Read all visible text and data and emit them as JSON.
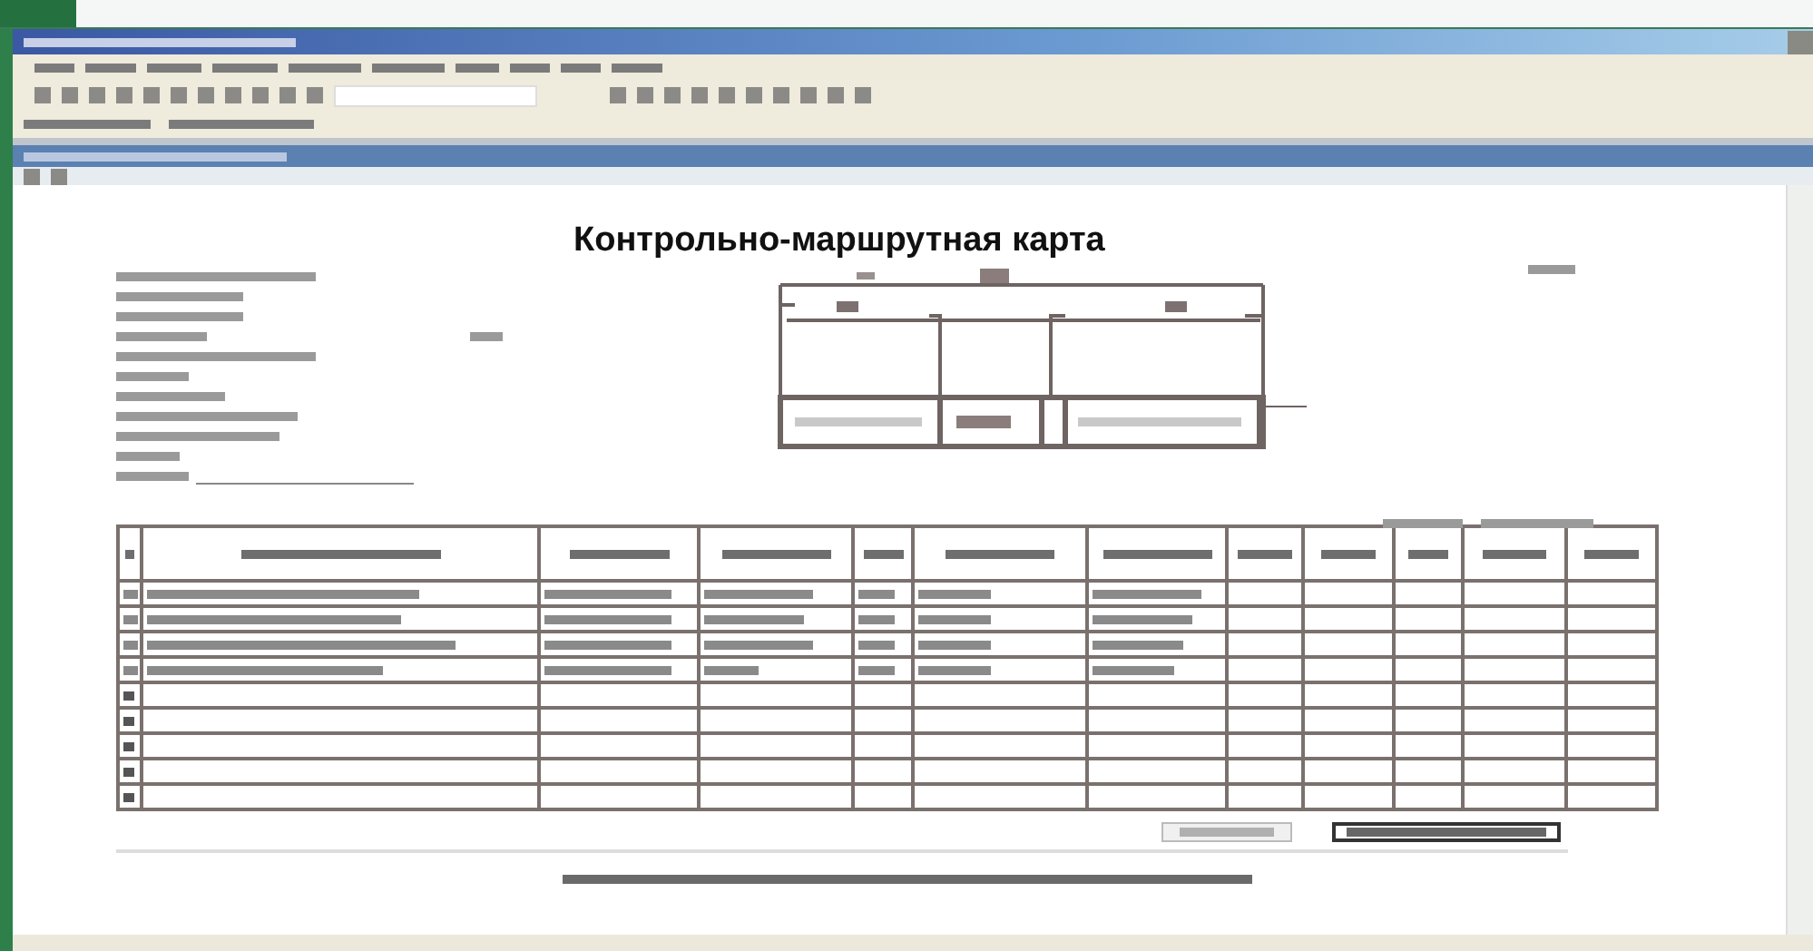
{
  "document": {
    "title": "Контрольно-маршрутная карта"
  },
  "table": {
    "rows": [
      {
        "kind": "filled"
      },
      {
        "kind": "filled"
      },
      {
        "kind": "filled"
      },
      {
        "kind": "filled"
      },
      {
        "kind": "empty"
      },
      {
        "kind": "empty"
      },
      {
        "kind": "empty"
      },
      {
        "kind": "empty"
      },
      {
        "kind": "empty"
      }
    ]
  }
}
